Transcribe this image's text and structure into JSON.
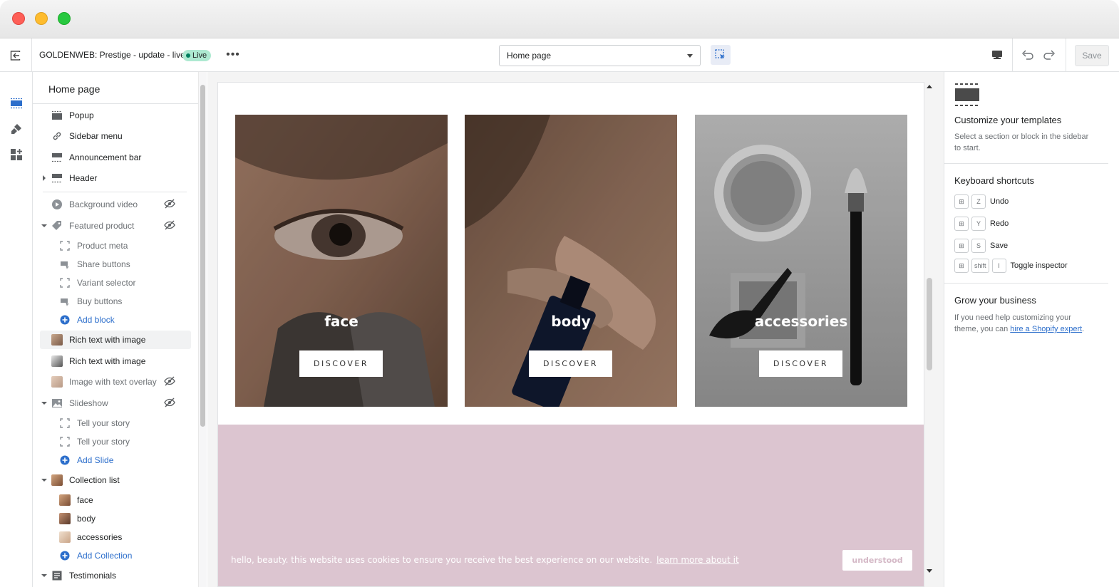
{
  "topbar": {
    "store_name": "GOLDENWEB: Prestige - update - live",
    "live_label": "Live",
    "more_label": "•••",
    "page_select": "Home page",
    "save_label": "Save"
  },
  "sidebar": {
    "title": "Home page",
    "items": [
      {
        "label": "Popup",
        "icon": "popup-icon"
      },
      {
        "label": "Sidebar menu",
        "icon": "link-icon"
      },
      {
        "label": "Announcement bar",
        "icon": "announcement-icon"
      },
      {
        "label": "Header",
        "icon": "header-icon"
      },
      {
        "label": "Background video",
        "icon": "play-icon"
      },
      {
        "label": "Featured product",
        "icon": "tag-icon"
      },
      {
        "label": "Product meta",
        "icon": "block-icon"
      },
      {
        "label": "Share buttons",
        "icon": "share-block-icon"
      },
      {
        "label": "Variant selector",
        "icon": "block-icon"
      },
      {
        "label": "Buy buttons",
        "icon": "buy-block-icon"
      },
      {
        "label": "Add block",
        "icon": "add-icon"
      },
      {
        "label": "Rich text with image",
        "icon": "thumbnail"
      },
      {
        "label": "Rich text with image",
        "icon": "thumbnail"
      },
      {
        "label": "Image with text overlay",
        "icon": "thumbnail"
      },
      {
        "label": "Slideshow",
        "icon": "image-icon"
      },
      {
        "label": "Tell your story",
        "icon": "block-icon"
      },
      {
        "label": "Tell your story",
        "icon": "block-icon"
      },
      {
        "label": "Add Slide",
        "icon": "add-icon"
      },
      {
        "label": "Collection list",
        "icon": "thumbnail"
      },
      {
        "label": "face",
        "icon": "thumbnail"
      },
      {
        "label": "body",
        "icon": "thumbnail"
      },
      {
        "label": "accessories",
        "icon": "thumbnail"
      },
      {
        "label": "Add Collection",
        "icon": "add-icon"
      },
      {
        "label": "Testimonials",
        "icon": "text-icon"
      }
    ]
  },
  "preview": {
    "collections": [
      {
        "title": "face",
        "button": "DISCOVER"
      },
      {
        "title": "body",
        "button": "DISCOVER"
      },
      {
        "title": "accessories",
        "button": "DISCOVER"
      }
    ],
    "cookie_text": "hello, beauty. this website uses cookies to ensure you receive the best experience on our website.",
    "cookie_link": "learn more about it",
    "cookie_button": "understood",
    "pink_color": "#dcc5d0"
  },
  "right_panel": {
    "customize_title": "Customize your templates",
    "customize_text": "Select a section or block in the sidebar to start.",
    "shortcuts_title": "Keyboard shortcuts",
    "shortcuts": [
      {
        "keys": [
          "⊞",
          "Z"
        ],
        "label": "Undo"
      },
      {
        "keys": [
          "⊞",
          "Y"
        ],
        "label": "Redo"
      },
      {
        "keys": [
          "⊞",
          "S"
        ],
        "label": "Save"
      },
      {
        "keys": [
          "⊞",
          "shift",
          "I"
        ],
        "label": "Toggle inspector"
      }
    ],
    "grow_title": "Grow your business",
    "grow_text_1": "If you need help customizing your theme, you can",
    "grow_link": "hire a Shopify expert",
    "grow_text_2": "."
  },
  "colors": {
    "accent": "#2c6ecb",
    "live_badge": "#aee9d1",
    "live_dot": "#007f5f"
  }
}
